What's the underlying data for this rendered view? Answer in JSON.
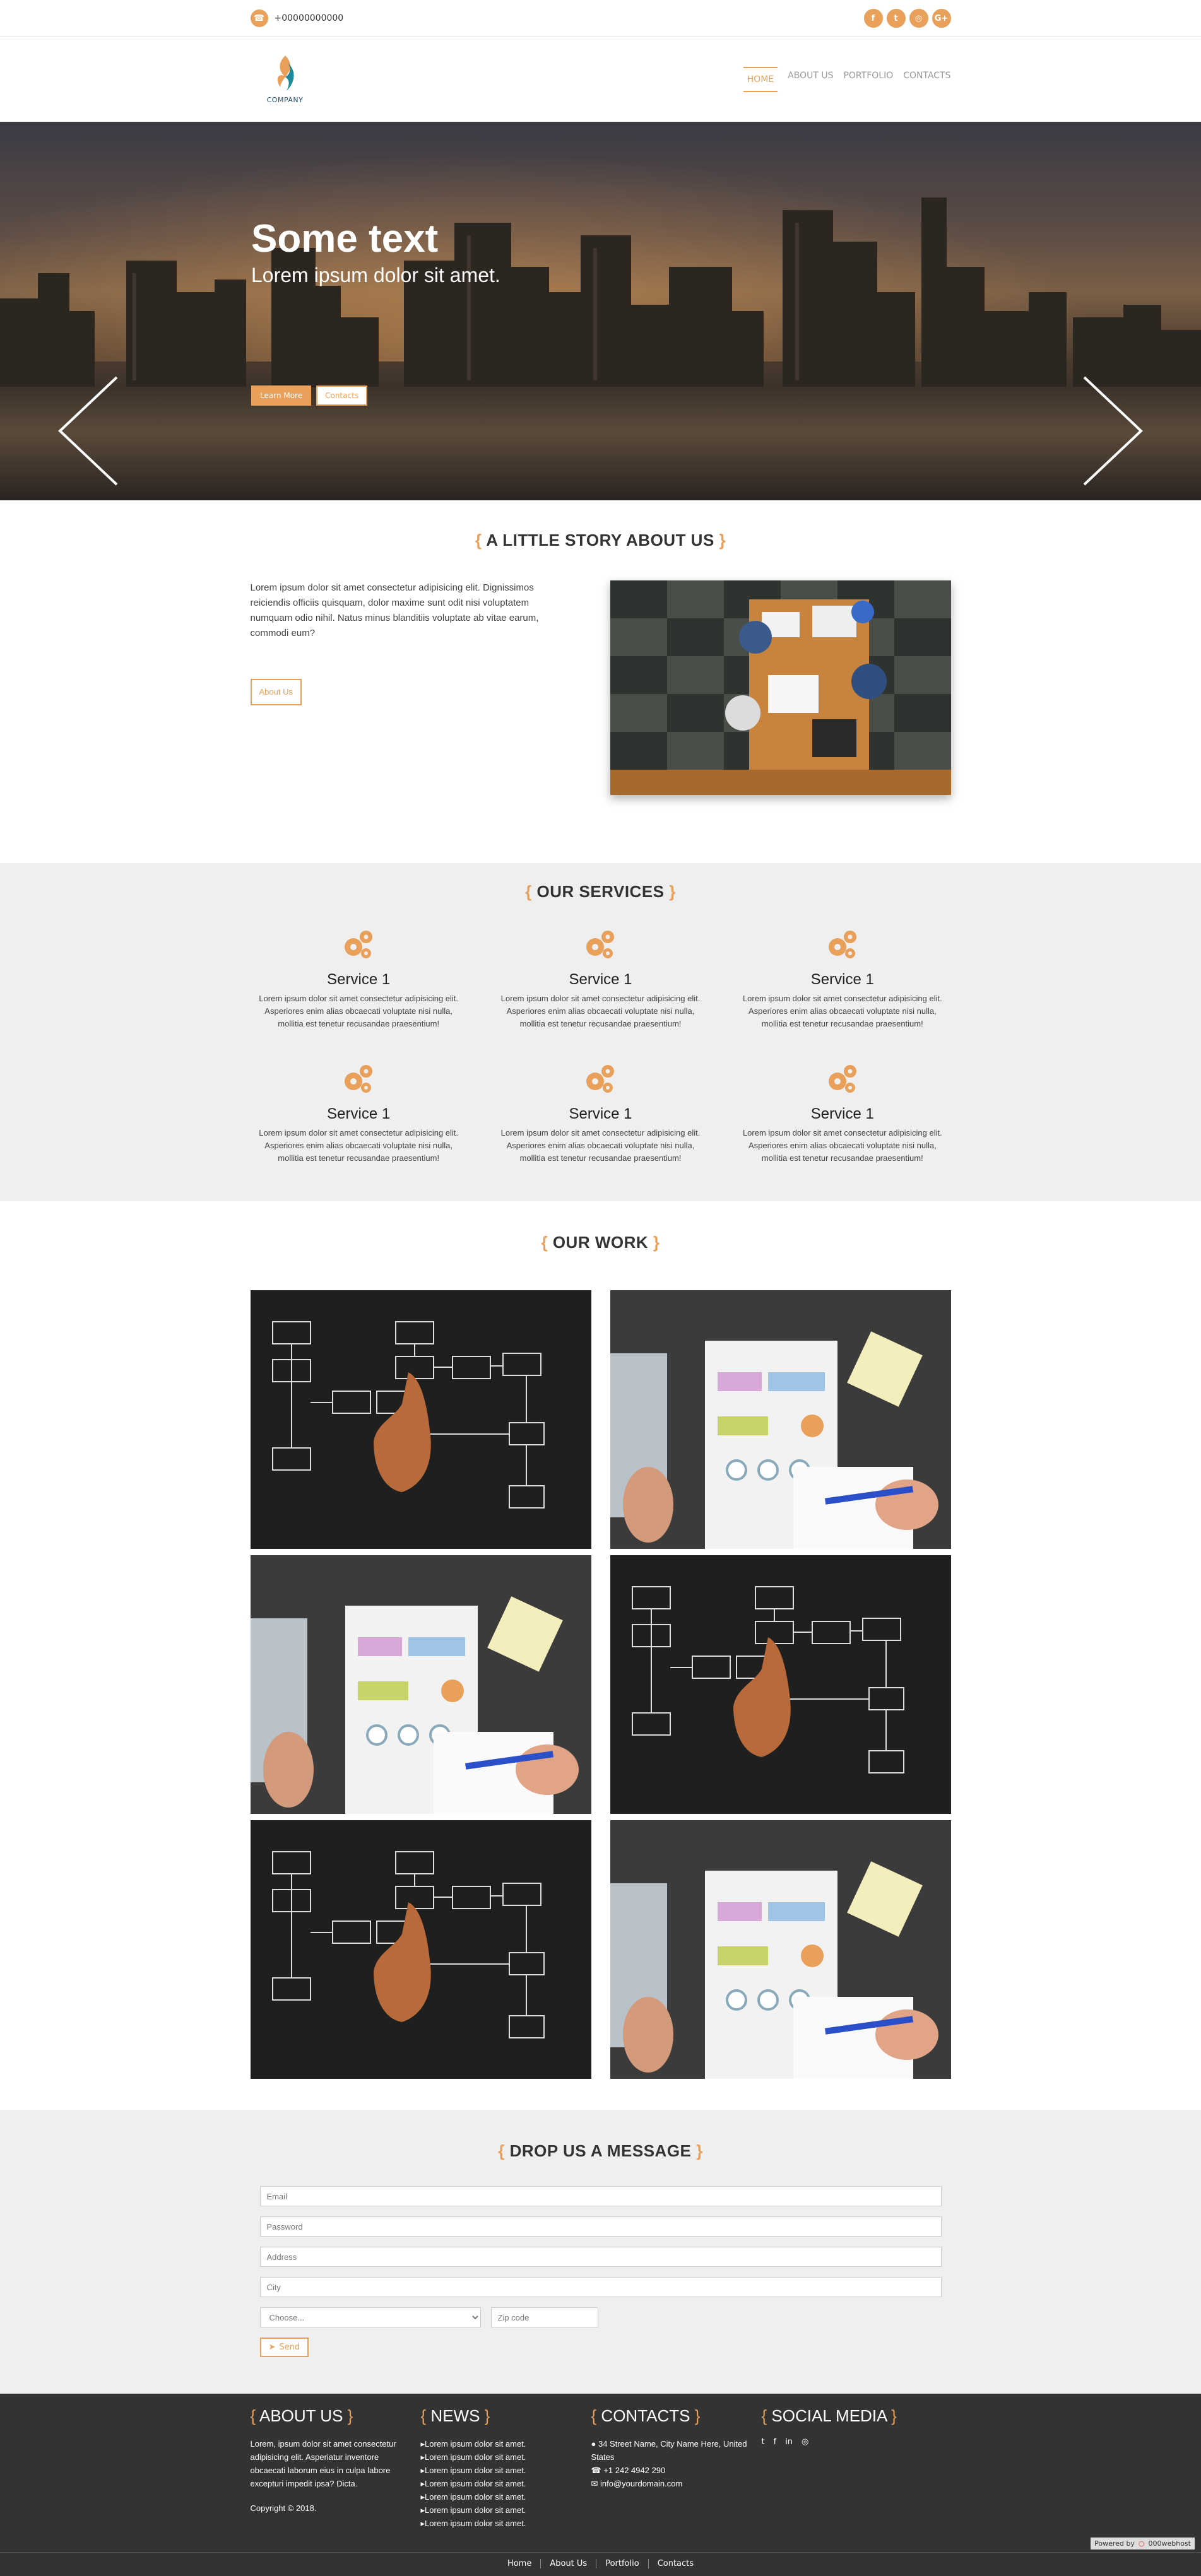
{
  "topbar": {
    "phone_icon": "phone-icon",
    "phone": "+00000000000",
    "socials": [
      {
        "icon": "facebook-icon",
        "glyph": "f"
      },
      {
        "icon": "twitter-icon",
        "glyph": "t"
      },
      {
        "icon": "instagram-icon",
        "glyph": "◎"
      },
      {
        "icon": "google-plus-icon",
        "glyph": "G+"
      }
    ]
  },
  "header": {
    "logo_text": "COMPANY",
    "nav": [
      "HOME",
      "ABOUT US",
      "PORTFOLIO",
      "CONTACTS"
    ],
    "active": "HOME"
  },
  "hero": {
    "title": "Some text",
    "subtitle": "Lorem ipsum dolor sit amet.",
    "primary_button": "Learn More",
    "secondary_button": "Contacts"
  },
  "about": {
    "title_open": "{",
    "title": " A LITTLE STORY ABOUT US ",
    "title_close": "}",
    "text": "Lorem ipsum dolor sit amet consectetur adipisicing elit. Dignissimos reiciendis officiis quisquam, dolor maxime sunt odit nisi voluptatem numquam odio nihil. Natus minus blanditiis voluptate ab vitae earum, commodi eum?",
    "button": "About Us"
  },
  "services": {
    "title": " OUR SERVICES ",
    "items": [
      {
        "name": "Service 1",
        "text": "Lorem ipsum dolor sit amet consectetur adipisicing elit. Asperiores enim alias obcaecati voluptate nisi nulla, mollitia est tenetur recusandae praesentium!"
      },
      {
        "name": "Service 1",
        "text": "Lorem ipsum dolor sit amet consectetur adipisicing elit. Asperiores enim alias obcaecati voluptate nisi nulla, mollitia est tenetur recusandae praesentium!"
      },
      {
        "name": "Service 1",
        "text": "Lorem ipsum dolor sit amet consectetur adipisicing elit. Asperiores enim alias obcaecati voluptate nisi nulla, mollitia est tenetur recusandae praesentium!"
      },
      {
        "name": "Service 1",
        "text": "Lorem ipsum dolor sit amet consectetur adipisicing elit. Asperiores enim alias obcaecati voluptate nisi nulla, mollitia est tenetur recusandae praesentium!"
      },
      {
        "name": "Service 1",
        "text": "Lorem ipsum dolor sit amet consectetur adipisicing elit. Asperiores enim alias obcaecati voluptate nisi nulla, mollitia est tenetur recusandae praesentium!"
      },
      {
        "name": "Service 1",
        "text": "Lorem ipsum dolor sit amet consectetur adipisicing elit. Asperiores enim alias obcaecati voluptate nisi nulla, mollitia est tenetur recusandae praesentium!"
      }
    ]
  },
  "work": {
    "title": " OUR WORK ",
    "items": [
      "flowchart",
      "charts",
      "charts",
      "flowchart",
      "flowchart",
      "charts"
    ]
  },
  "contact": {
    "title": " DROP US A MESSAGE ",
    "fields": {
      "email": "Email",
      "password": "Password",
      "address": "Address",
      "city": "City",
      "choose": "Choose...",
      "zip": "Zip code"
    },
    "send": "Send"
  },
  "footer": {
    "about_title": " ABOUT US ",
    "about_text": "Lorem, ipsum dolor sit amet consectetur adipisicing elit. Asperiatur inventore obcaecati laborum eius in culpa labore excepturi impedit ipsa? Dicta.",
    "copyright": "Copyright © 2018.",
    "news_title": " NEWS ",
    "news": [
      "Lorem ipsum dolor sit amet.",
      "Lorem ipsum dolor sit amet.",
      "Lorem ipsum dolor sit amet.",
      "Lorem ipsum dolor sit amet.",
      "Lorem ipsum dolor sit amet.",
      "Lorem ipsum dolor sit amet.",
      "Lorem ipsum dolor sit amet."
    ],
    "contacts_title": " CONTACTS ",
    "address": "34 Street Name, City Name Here, United States",
    "phone": "+1 242 4942 290",
    "email": "info@yourdomain.com",
    "social_title": " SOCIAL MEDIA ",
    "bottom_links": [
      "Home",
      "About Us",
      "Portfolio",
      "Contacts"
    ],
    "powered_by": "Powered by",
    "powered_brand": "000webhost"
  },
  "colors": {
    "accent": "#e8a05a",
    "footer_bg": "#333333",
    "section_bg": "#efefef"
  }
}
